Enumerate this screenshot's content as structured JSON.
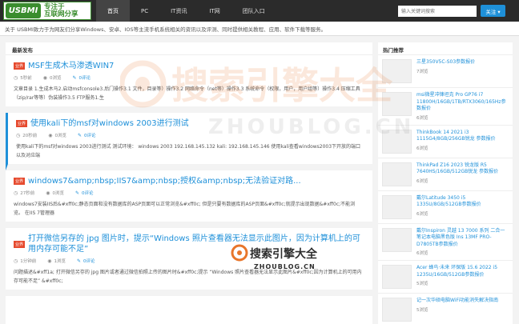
{
  "nav": {
    "logo_badge": "USBMI",
    "logo_text_1": "专注于",
    "logo_text_2": "互联网分享",
    "items": [
      "首页",
      "PC",
      "IT资讯",
      "IT网",
      "团队入口"
    ],
    "search_placeholder": "输入关键词搜索",
    "follow_label": "关注 ▾"
  },
  "about_text": "关于 USBMI致力于为网友们分享Windows、安卓、IOS等主流手机系统相关的资讯以及评测、同时提供相关教程、应用、软件下载等服务。",
  "main": {
    "header": "最新发布",
    "posts": [
      {
        "badge": "业界",
        "title": "MSF生成木马渗透WIN7",
        "time": "5秒前",
        "views": "0浏览",
        "comments": "0评论",
        "excerpt": "文章目录 1.生成木马2.启动msfconsole3.后门操作3.1 文件，目录等）操作3.2 网络命令（net等）操作3.3 系统命令（权限，用户，用户组等）操作3.4 压缩工具（zip/rar等等）伪装操作3.5 FTP服务1.生"
      },
      {
        "badge": "业界",
        "title": "使用kali下的msf对windows 2003进行测试",
        "time": "20秒前",
        "views": "0浏览",
        "comments": "0评论",
        "excerpt": "使用kali下的msf对windows 2003进行测试 测试环境： windows 2003 192.168.145.132 kali: 192.168.145.146 使用kali查看windows2003下开放的端口以及对应端"
      },
      {
        "badge": "业界",
        "title": "windows7&amp;nbsp;IIS7&amp;nbsp;授权&amp;nbsp;无法验证对路...",
        "time": "27秒前",
        "views": "0浏览",
        "comments": "0评论",
        "excerpt": "windows7安装IIS后&#xff0c;静态页面和没有数据库的ASP页面可以正常浏览&#xff0c; 但是只要有数据库的ASP页面&#xff0c;就提示出现数据&#xff0c;不能浏览。 在IIS 7管理器"
      },
      {
        "badge": "业界",
        "title": "打开微信另存的 jpg 图片时，提示“Windows 照片查看器无法显示此图片，因为计算机上的可用内存可能不足”",
        "time": "1分钟前",
        "views": "1浏览",
        "comments": "0评论",
        "excerpt": "问题描述&#xff1a; 打开微信另存的 jpg 图片或者通过微信拍照上传的图片时&#xff0c;提示 “Windows 照片查看器无法显示此图片&#xff0c;因为计算机上的可用内存可能不足” &#xff0c;"
      }
    ]
  },
  "side": {
    "header": "热门推荐",
    "items": [
      {
        "title": "三星350V5C-S03参数报价",
        "views": "7浏览"
      },
      {
        "title": "msi微星冲锋坦克 Pro GP76 i7 11800H/16GB/1TB/RTX3060/165Hz参数报价",
        "views": "6浏览"
      },
      {
        "title": "ThinkBook 14 2021 i3 1115G4/8GB/256GB锐龙 参数报价",
        "views": "6浏览"
      },
      {
        "title": "ThinkPad Z16 2023 锐龙版 R5 7640HS/16GB/512GB锐龙 参数报价",
        "views": "6浏览"
      },
      {
        "title": "戴尔Latitude 3450 i5 1335U/8GB/512GB参数报价",
        "views": "6浏览"
      },
      {
        "title": "戴尔Inspiron 灵越 13 7000 系列 二合一笔记本电脑黑色版 Ins 13MF PRO-D7805TB参数报价",
        "views": "6浏览"
      },
      {
        "title": "Acer 蜂鸟·未来 环保版 15.6 2022 i5 1235U/16GB/512GB参数报价",
        "views": "5浏览"
      },
      {
        "title": "记一次华硕电脑WiFi功能消失解决指南",
        "views": "5浏览"
      }
    ]
  },
  "watermark": {
    "big_text": "搜索引擎大全",
    "big_sub": "ZHOUBLOG.CN",
    "small_text": "搜索引擎大全",
    "small_sub": "ZHOUBLOG.CN"
  }
}
